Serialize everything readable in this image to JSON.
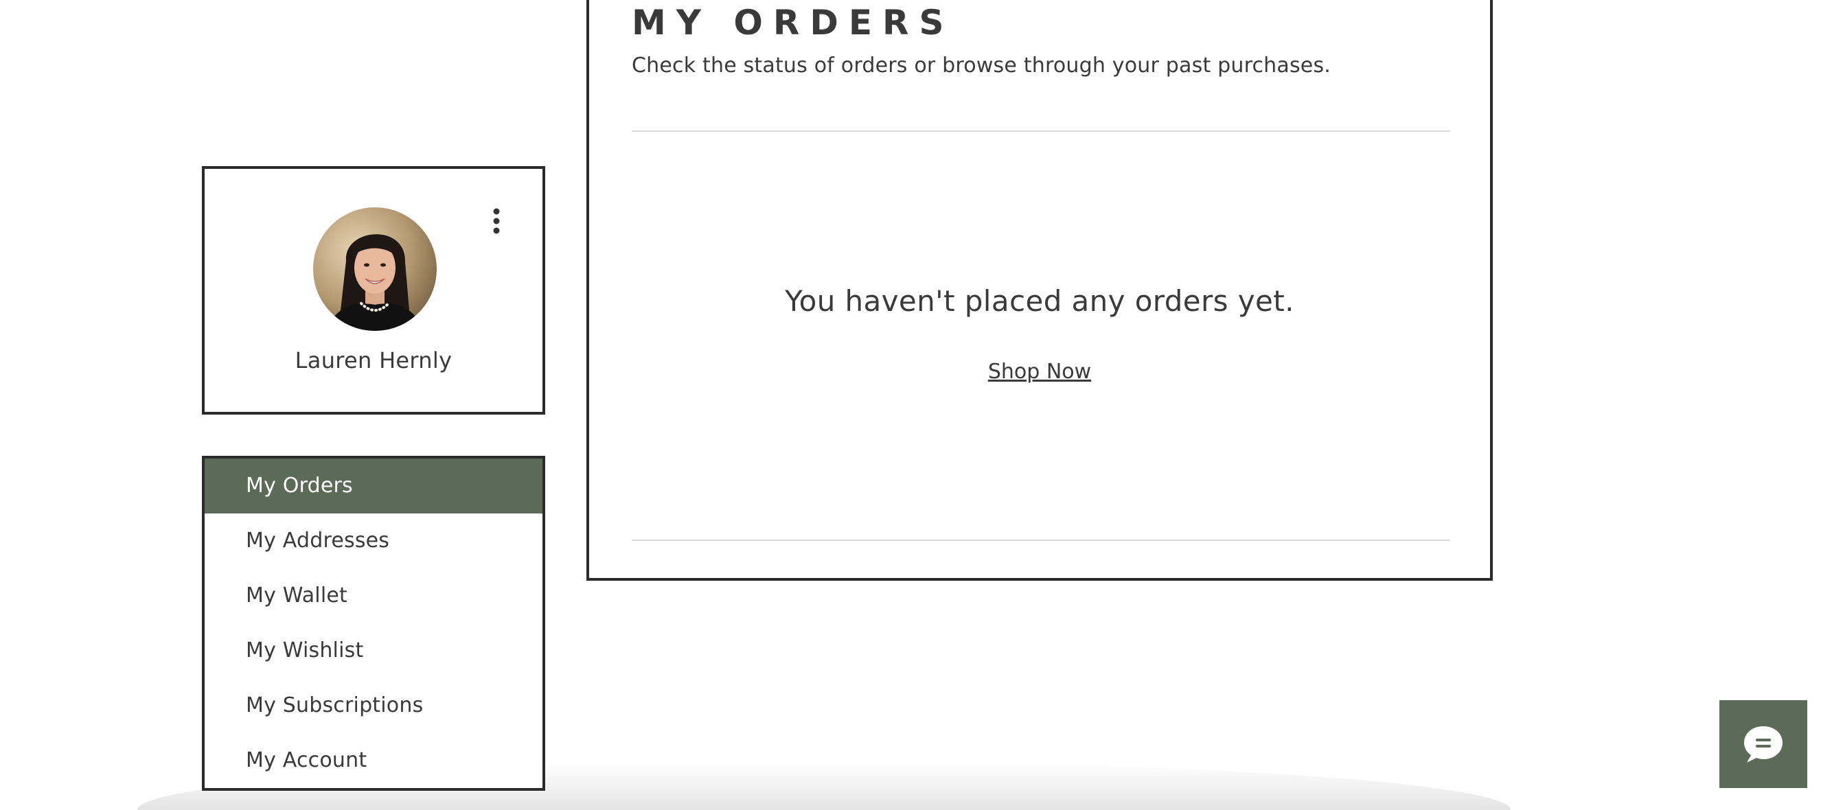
{
  "profile": {
    "name": "Lauren Hernly",
    "avatar_icon": "user-photo",
    "menu_icon": "kebab-menu-icon"
  },
  "nav": {
    "items": [
      {
        "label": "My Orders",
        "active": true
      },
      {
        "label": "My Addresses",
        "active": false
      },
      {
        "label": "My Wallet",
        "active": false
      },
      {
        "label": "My Wishlist",
        "active": false
      },
      {
        "label": "My Subscriptions",
        "active": false
      },
      {
        "label": "My Account",
        "active": false
      }
    ]
  },
  "orders": {
    "title": "MY ORDERS",
    "subtitle": "Check the status of orders or browse through your past purchases.",
    "empty_message": "You haven't placed any orders yet.",
    "shop_now_label": "Shop Now"
  },
  "chat": {
    "icon": "chat-bubble-icon"
  },
  "colors": {
    "accent": "#5b6b57",
    "border": "#2b2b2b",
    "text": "#3a3a3a",
    "divider": "#d8d8d8"
  }
}
